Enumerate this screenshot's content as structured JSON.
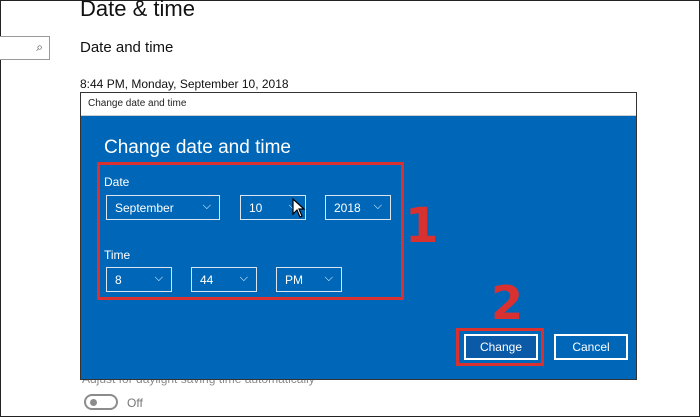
{
  "settings": {
    "page_title": "Date & time",
    "section_title": "Date and time",
    "current_datetime": "8:44 PM, Monday, September 10, 2018",
    "faded_setting": "Adjust for daylight saving time automatically",
    "toggle_state": "Off",
    "search_icon": "search-icon"
  },
  "dialog": {
    "window_title": "Change date and time",
    "heading": "Change date and time",
    "date_label": "Date",
    "time_label": "Time",
    "month": "September",
    "day": "10",
    "year": "2018",
    "hour": "8",
    "minute": "44",
    "ampm": "PM",
    "change_label": "Change",
    "cancel_label": "Cancel"
  },
  "annotations": {
    "step1": "1",
    "step2": "2"
  },
  "colors": {
    "dialog_bg": "#0067b8",
    "annotation_red": "#d93030"
  }
}
